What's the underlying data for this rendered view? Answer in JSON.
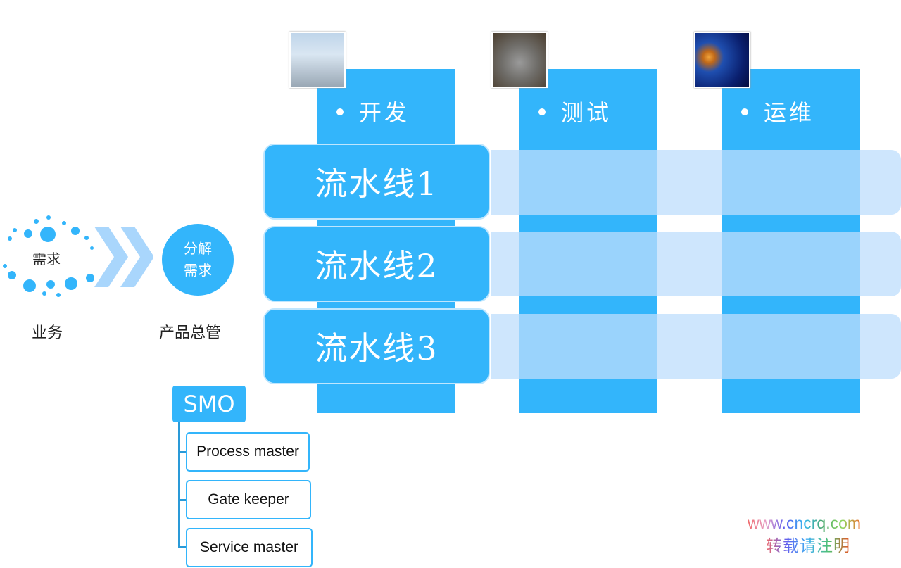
{
  "stages": [
    {
      "label": "开发",
      "image": "penguins-photo"
    },
    {
      "label": "测试",
      "image": "koala-photo"
    },
    {
      "label": "运维",
      "image": "jellyfish-photo"
    }
  ],
  "pipelines": [
    "流水线1",
    "流水线2",
    "流水线3"
  ],
  "flow": {
    "demand_label": "需求",
    "demand_owner": "业务",
    "decompose_label_line1": "分解",
    "decompose_label_line2": "需求",
    "decompose_owner": "产品总管"
  },
  "smo": {
    "title": "SMO",
    "roles": [
      "Process master",
      "Gate keeper",
      "Service master"
    ]
  },
  "watermark": {
    "line1": "www.cncrq.com",
    "line2": "转载请注明"
  },
  "colors": {
    "primary": "#33b5fb",
    "band": "#bedefc",
    "chevron": "#a9d6fc"
  }
}
